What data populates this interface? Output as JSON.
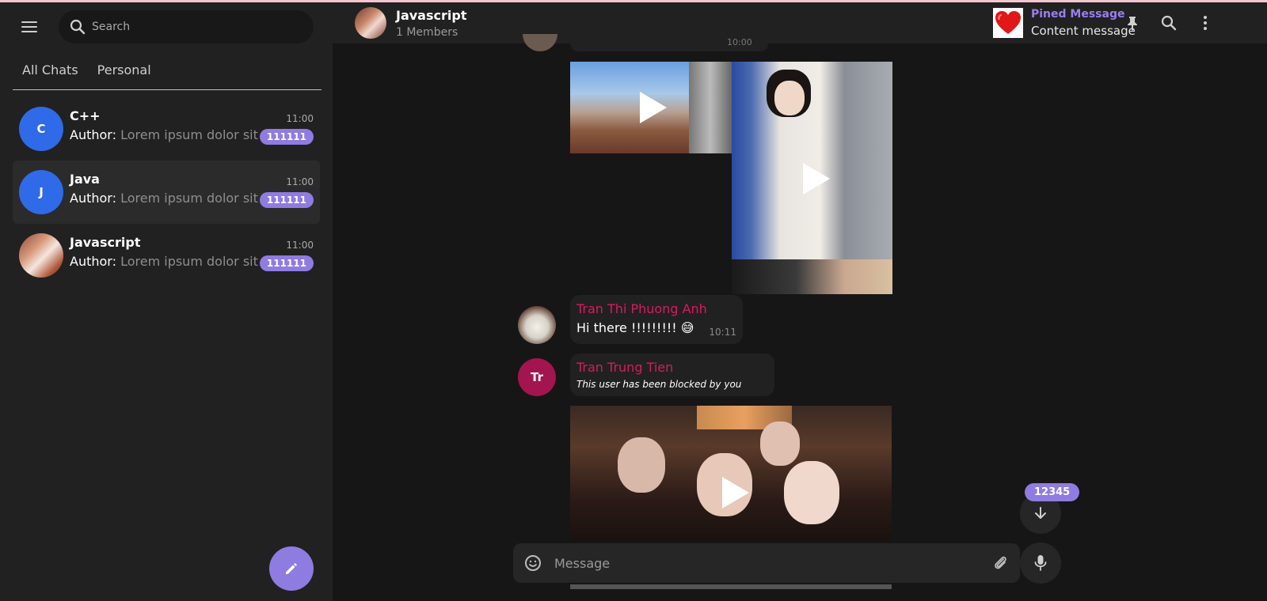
{
  "sidebar": {
    "search_placeholder": "Search",
    "tabs": [
      {
        "label": "All Chats"
      },
      {
        "label": "Personal"
      }
    ],
    "chats": [
      {
        "initial": "C",
        "name": "C++",
        "time": "11:00",
        "author": "Author:",
        "preview": "Lorem ipsum dolor sit ...",
        "badge": "111111"
      },
      {
        "initial": "J",
        "name": "Java",
        "time": "11:00",
        "author": "Author:",
        "preview": "Lorem ipsum dolor sit ...",
        "badge": "111111"
      },
      {
        "initial": "",
        "name": "Javascript",
        "time": "11:00",
        "author": "Author:",
        "preview": "Lorem ipsum dolor sit ...",
        "badge": "111111"
      }
    ]
  },
  "header": {
    "title": "Javascript",
    "subtitle": "1 Members",
    "pinned_title": "Pined Message",
    "pinned_text": "Content message"
  },
  "messages": {
    "stub_time": "10:00",
    "msg1": {
      "sender": "Tran Thi Phuong Anh",
      "text": "Hi there !!!!!!!!! 😅",
      "time": "10:11"
    },
    "msg2": {
      "sender": "Tran Trung Tien",
      "avatar_initials": "Tr",
      "text": "This user has been blocked by you"
    }
  },
  "composer": {
    "placeholder": "Message",
    "unread_count": "12345"
  },
  "colors": {
    "accent": "#8f7ce0",
    "sender": "#d81b60",
    "avatar_blue": "#2f6ae8"
  }
}
